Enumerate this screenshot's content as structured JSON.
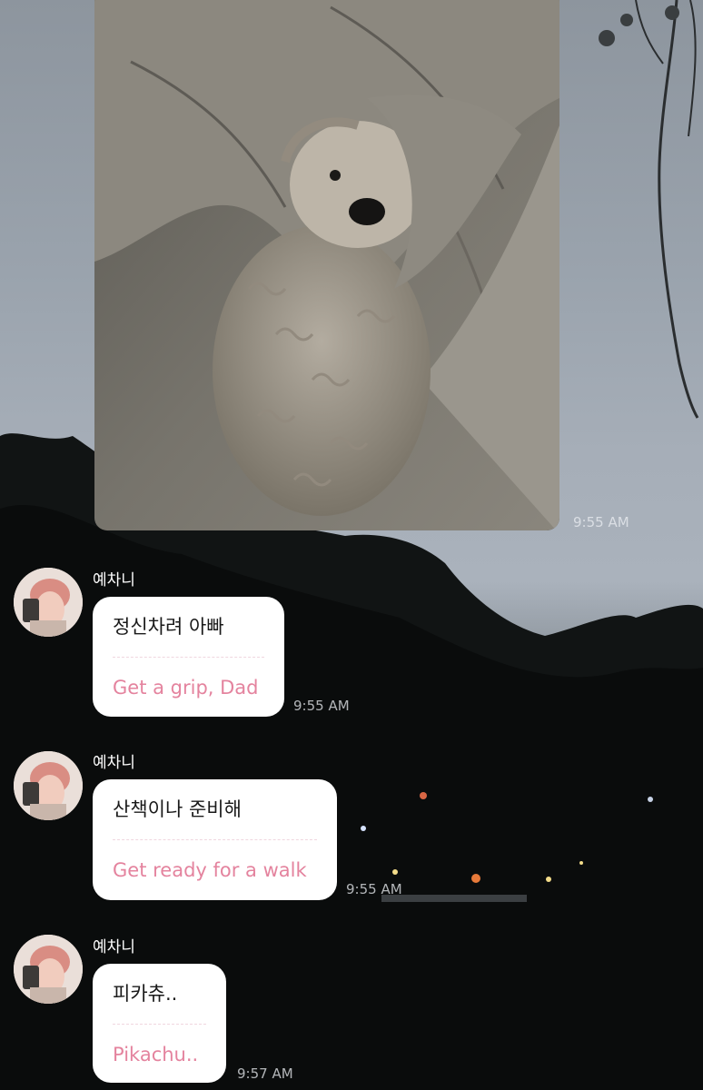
{
  "background": {
    "sky_color": "#9ea7b1",
    "tree_color": "#0c0f0f",
    "icon": "sky-trees-wallpaper"
  },
  "photo_message": {
    "content": "dog-photo",
    "time": "9:55 AM"
  },
  "messages": [
    {
      "sender": "예차니",
      "text": "정신차려 아빠",
      "translation": "Get a grip, Dad",
      "time": "9:55 AM"
    },
    {
      "sender": "예차니",
      "text": "산책이나 준비해",
      "translation": "Get ready for a walk",
      "time": "9:55 AM"
    },
    {
      "sender": "예차니",
      "text": "피카츄..",
      "translation": "Pikachu..",
      "time": "9:57 AM"
    }
  ],
  "colors": {
    "bubble": "#ffffff",
    "translation_text": "#e4839e",
    "timestamp": "#e6e8ec"
  }
}
